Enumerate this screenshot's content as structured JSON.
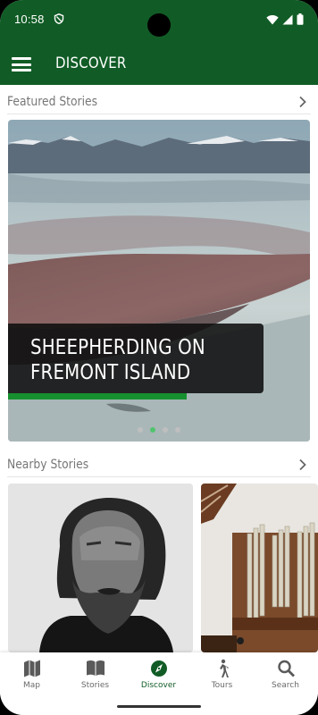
{
  "status_bar": {
    "time": "10:58",
    "icons": [
      "shield-icon",
      "wifi-icon",
      "signal-icon",
      "battery-icon"
    ]
  },
  "app_bar": {
    "title": "DISCOVER",
    "menu_icon": "hamburger-menu-icon",
    "color": "#115c26"
  },
  "featured": {
    "heading": "Featured Stories",
    "story_title": "SHEEPHERDING ON FREMONT ISLAND",
    "carousel": {
      "pages": 4,
      "active_index": 1
    }
  },
  "nearby": {
    "heading": "Nearby Stories",
    "cards": [
      {
        "image": "portrait-photo"
      },
      {
        "image": "pipe-organ-photo"
      }
    ]
  },
  "bottom_nav": {
    "items": [
      {
        "label": "Map",
        "icon": "map-icon",
        "active": false
      },
      {
        "label": "Stories",
        "icon": "book-icon",
        "active": false
      },
      {
        "label": "Discover",
        "icon": "compass-icon",
        "active": true
      },
      {
        "label": "Tours",
        "icon": "walking-person-icon",
        "active": false
      },
      {
        "label": "Search",
        "icon": "search-icon",
        "active": false
      }
    ]
  },
  "colors": {
    "primary": "#115c26",
    "accent": "#17912f",
    "dot_active": "#4fc46d"
  }
}
